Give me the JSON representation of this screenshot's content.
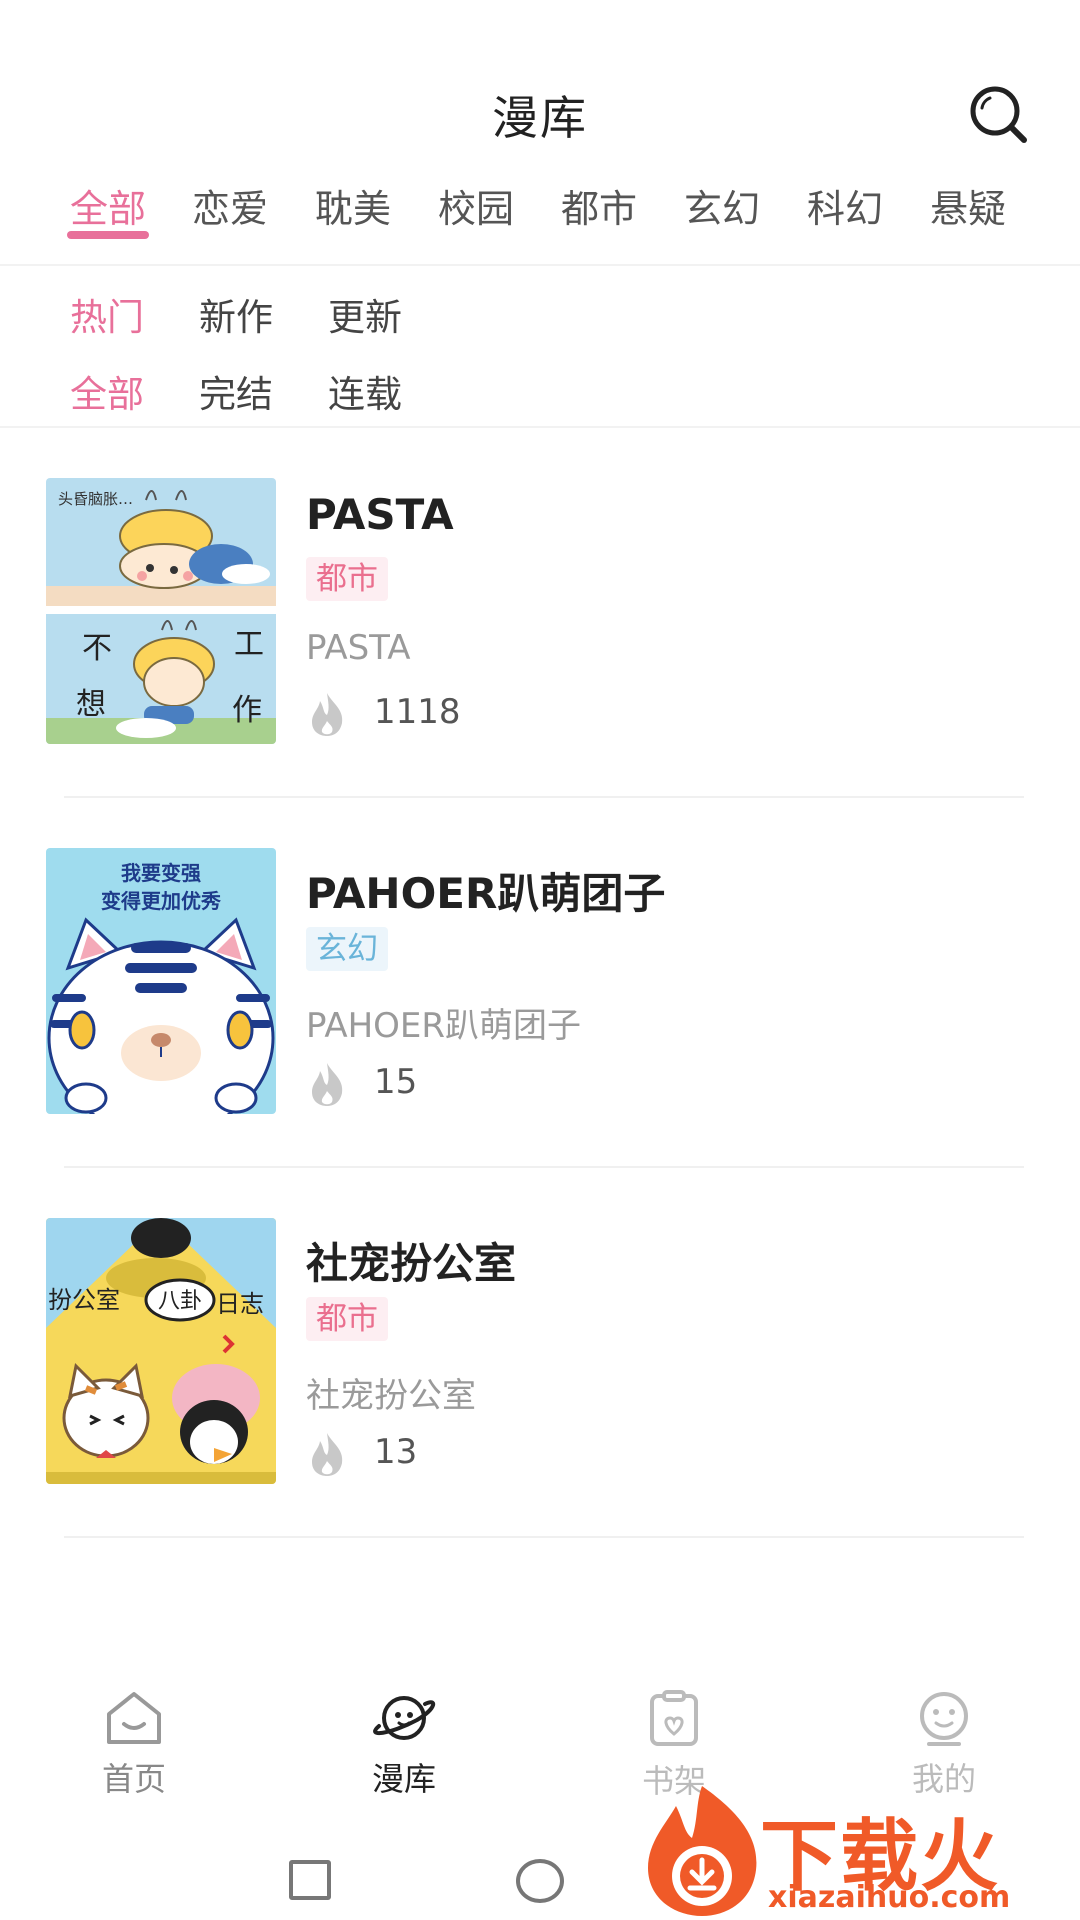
{
  "header": {
    "title": "漫库"
  },
  "genre_tabs": [
    "全部",
    "恋爱",
    "耽美",
    "校园",
    "都市",
    "玄幻",
    "科幻",
    "悬疑"
  ],
  "active_genre": "全部",
  "sort_filters": [
    "热门",
    "新作",
    "更新"
  ],
  "active_sort": "热门",
  "status_filters": [
    "全部",
    "完结",
    "连载"
  ],
  "active_status": "全部",
  "comics": [
    {
      "title": "PASTA",
      "tag": "都市",
      "tag_color": "#ea6f8e",
      "subtitle": "PASTA",
      "heat": "1118",
      "cover_text": [
        "头昏脑胀…",
        "不",
        "想",
        "工",
        "作"
      ]
    },
    {
      "title": "PAHOER趴萌团子",
      "tag": "玄幻",
      "tag_color": "#6ab4d9",
      "subtitle": "PAHOER趴萌团子",
      "heat": "15",
      "cover_text": [
        "我要变强",
        "变得更加优秀"
      ]
    },
    {
      "title": "社宠扮公室",
      "tag": "都市",
      "tag_color": "#ea6f8e",
      "subtitle": "社宠扮公室",
      "heat": "13",
      "cover_text": [
        "扮公室",
        "八卦",
        "日志"
      ]
    }
  ],
  "bottom_nav": [
    {
      "label": "首页",
      "icon": "home-icon"
    },
    {
      "label": "漫库",
      "icon": "planet-icon",
      "active": true
    },
    {
      "label": "书架",
      "icon": "bookshelf-icon"
    },
    {
      "label": "我的",
      "icon": "profile-icon"
    }
  ],
  "watermark": {
    "text": "下载火",
    "url": "xiazaihuo.com"
  },
  "colors": {
    "accent": "#e8709a",
    "watermark": "#f05a28"
  }
}
